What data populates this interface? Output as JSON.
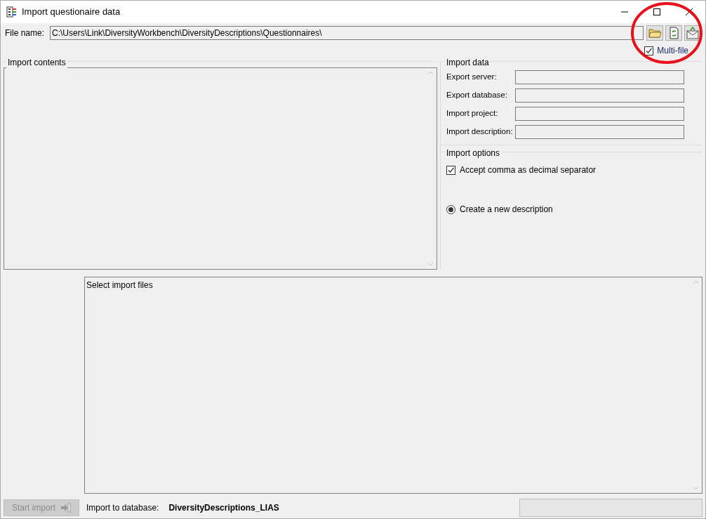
{
  "window": {
    "title": "Import questionaire data"
  },
  "file_name": {
    "label": "File name:",
    "value": "C:\\Users\\Link\\DiversityWorkbench\\DiversityDescriptions\\Questionnaires\\"
  },
  "multi_file": {
    "label": "Multi-file",
    "checked": true
  },
  "import_contents": {
    "title": "Import contents"
  },
  "import_data": {
    "title": "Import data",
    "fields": [
      {
        "label": "Export server:"
      },
      {
        "label": "Export database:"
      },
      {
        "label": "Import project:"
      },
      {
        "label": "Import description:"
      }
    ]
  },
  "import_options": {
    "title": "Import options",
    "options": [
      {
        "kind": "checkbox",
        "label": "Accept comma as decimal separator",
        "checked": true
      },
      {
        "kind": "radio",
        "label": "Create a new description",
        "checked": true
      }
    ]
  },
  "log": {
    "text": "Select import files"
  },
  "start_button": {
    "label": "Start import",
    "disabled": true
  },
  "database": {
    "label": "Import to database:",
    "value": "DiversityDescriptions_LIAS"
  },
  "progress": {
    "level": 0
  }
}
